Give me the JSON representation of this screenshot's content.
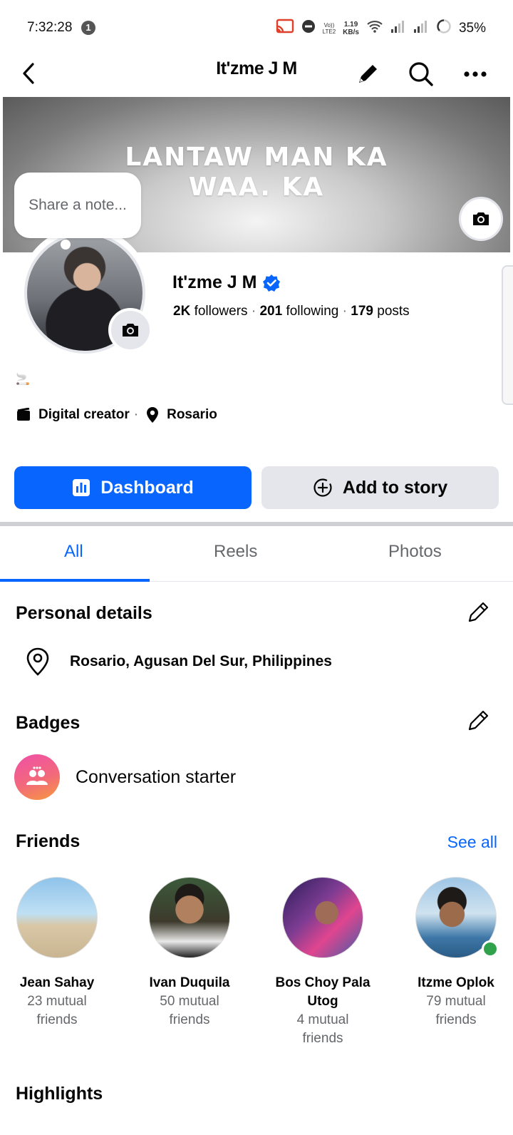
{
  "status_bar": {
    "time": "7:32:28",
    "notification_count": "1",
    "volte_top": "Vo))",
    "volte_bottom": "LTE2",
    "speed_value": "1.19",
    "speed_unit": "KB/s",
    "battery": "35%"
  },
  "header": {
    "title": "It'zme J M",
    "icons": [
      "back-arrow-icon",
      "pencil-icon",
      "search-icon",
      "more-icon"
    ]
  },
  "cover": {
    "text_line1": "LANTAW MAN KA",
    "text_line2": "WAA. KA"
  },
  "note": {
    "placeholder": "Share a note..."
  },
  "profile": {
    "name": "It'zme J M",
    "verified": true,
    "followers_count": "2K",
    "followers_label": "followers",
    "following_count": "201",
    "following_label": "following",
    "posts_count": "179",
    "posts_label": "posts",
    "bio_emoji": "🚬",
    "category": "Digital creator",
    "location": "Rosario"
  },
  "actions": {
    "dashboard_label": "Dashboard",
    "add_story_label": "Add to story",
    "accent": "#0866ff"
  },
  "tabs": [
    {
      "label": "All",
      "active": true
    },
    {
      "label": "Reels",
      "active": false
    },
    {
      "label": "Photos",
      "active": false
    }
  ],
  "personal_details": {
    "title": "Personal details",
    "location": "Rosario, Agusan Del Sur, Philippines"
  },
  "badges": {
    "title": "Badges",
    "items": [
      {
        "label": "Conversation starter"
      }
    ]
  },
  "friends": {
    "title": "Friends",
    "see_all": "See all",
    "items": [
      {
        "name": "Jean Sahay",
        "mutual_1": "23 mutual",
        "mutual_2": "friends",
        "online": false
      },
      {
        "name": "Ivan Duquila",
        "mutual_1": "50 mutual",
        "mutual_2": "friends",
        "online": false
      },
      {
        "name_1": "Bos Choy Pala",
        "name_2": "Utog",
        "mutual_1": "4 mutual",
        "mutual_2": "friends",
        "online": false
      },
      {
        "name": "Itzme Oplok",
        "mutual_1": "79 mutual",
        "mutual_2": "friends",
        "online": true
      }
    ]
  },
  "highlights": {
    "title": "Highlights"
  }
}
